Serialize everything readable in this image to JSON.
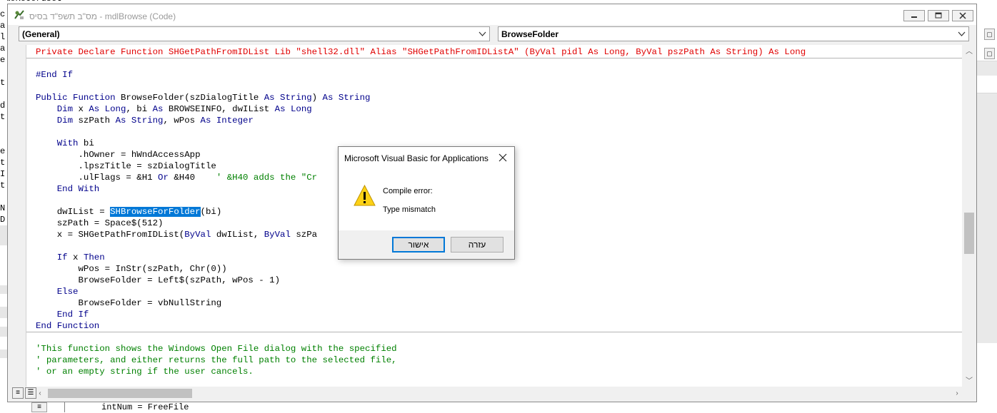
{
  "window": {
    "title": "מס\"ב תשפ\"ד בסיס - mdlBrowse (Code)",
    "minimize_label": "–",
    "restore_label": "▢",
    "close_label": "✕"
  },
  "combos": {
    "object": "(General)",
    "procedure": "BrowseFolder"
  },
  "code_lines": [
    [
      {
        "t": "Private Declare Function SHGetPathFromIDList Lib \"shell32.dll\" Alias \"SHGetPathFromIDListA\" (ByVal pidl As Long, ByVal pszPath As String) As Long",
        "c": "red"
      }
    ],
    [],
    [
      {
        "t": "#End If",
        "c": "kw"
      }
    ],
    [],
    [
      {
        "t": "Public Function ",
        "c": "kw"
      },
      {
        "t": "BrowseFolder(szDialogTitle "
      },
      {
        "t": "As String",
        "c": "kw"
      },
      {
        "t": ") "
      },
      {
        "t": "As String",
        "c": "kw"
      }
    ],
    [
      {
        "t": "    "
      },
      {
        "t": "Dim",
        "c": "kw"
      },
      {
        "t": " x "
      },
      {
        "t": "As Long",
        "c": "kw"
      },
      {
        "t": ", bi "
      },
      {
        "t": "As",
        "c": "kw"
      },
      {
        "t": " BROWSEINFO, dwIList "
      },
      {
        "t": "As Long",
        "c": "kw"
      }
    ],
    [
      {
        "t": "    "
      },
      {
        "t": "Dim",
        "c": "kw"
      },
      {
        "t": " szPath "
      },
      {
        "t": "As String",
        "c": "kw"
      },
      {
        "t": ", wPos "
      },
      {
        "t": "As Integer",
        "c": "kw"
      }
    ],
    [],
    [
      {
        "t": "    "
      },
      {
        "t": "With",
        "c": "kw"
      },
      {
        "t": " bi"
      }
    ],
    [
      {
        "t": "        .hOwner = hWndAccessApp"
      }
    ],
    [
      {
        "t": "        .lpszTitle = szDialogTitle"
      }
    ],
    [
      {
        "t": "        .ulFlags = &H1 "
      },
      {
        "t": "Or",
        "c": "kw"
      },
      {
        "t": " &H40    "
      },
      {
        "t": "' &H40 adds the \"Cr",
        "c": "cm"
      }
    ],
    [
      {
        "t": "    "
      },
      {
        "t": "End With",
        "c": "kw"
      }
    ],
    [],
    [
      {
        "t": "    dwIList = "
      },
      {
        "t": "SHBrowseForFolder",
        "c": "sel"
      },
      {
        "t": "(bi)"
      }
    ],
    [
      {
        "t": "    szPath = Space$(512)"
      }
    ],
    [
      {
        "t": "    x = SHGetPathFromIDList("
      },
      {
        "t": "ByVal",
        "c": "kw"
      },
      {
        "t": " dwIList, "
      },
      {
        "t": "ByVal",
        "c": "kw"
      },
      {
        "t": " szPa"
      }
    ],
    [],
    [
      {
        "t": "    "
      },
      {
        "t": "If",
        "c": "kw"
      },
      {
        "t": " x "
      },
      {
        "t": "Then",
        "c": "kw"
      }
    ],
    [
      {
        "t": "        wPos = InStr(szPath, Chr(0))"
      }
    ],
    [
      {
        "t": "        BrowseFolder = Left$(szPath, wPos - 1)"
      }
    ],
    [
      {
        "t": "    "
      },
      {
        "t": "Else",
        "c": "kw"
      }
    ],
    [
      {
        "t": "        BrowseFolder = vbNullString"
      }
    ],
    [
      {
        "t": "    "
      },
      {
        "t": "End If",
        "c": "kw"
      }
    ],
    [
      {
        "t": "End Function",
        "c": "kw"
      }
    ],
    [],
    [
      {
        "t": "'This function shows the Windows Open File dialog with the specified",
        "c": "cm"
      }
    ],
    [
      {
        "t": "' parameters, and either returns the full path to the selected file,",
        "c": "cm"
      }
    ],
    [
      {
        "t": "' or an empty string if the user cancels.",
        "c": "cm"
      }
    ]
  ],
  "dialog": {
    "title": "Microsoft Visual Basic for Applications",
    "line1": "Compile error:",
    "line2": "Type mismatch",
    "ok_label": "אישור",
    "help_label": "עזרה",
    "icon": "warning-icon"
  },
  "background": {
    "left_fragments": [
      "c",
      "a",
      "l",
      "a",
      "e",
      "",
      "t",
      "d",
      "t",
      "",
      "e",
      "t",
      "I",
      "t",
      "",
      "N",
      "D"
    ],
    "top_fragment": "baoRecordset",
    "bottom_code": "intNum = FreeFile"
  },
  "colors": {
    "keyword": "#00008b",
    "declare_line": "#e00000",
    "comment": "#008000",
    "selection": "#0078d7"
  }
}
